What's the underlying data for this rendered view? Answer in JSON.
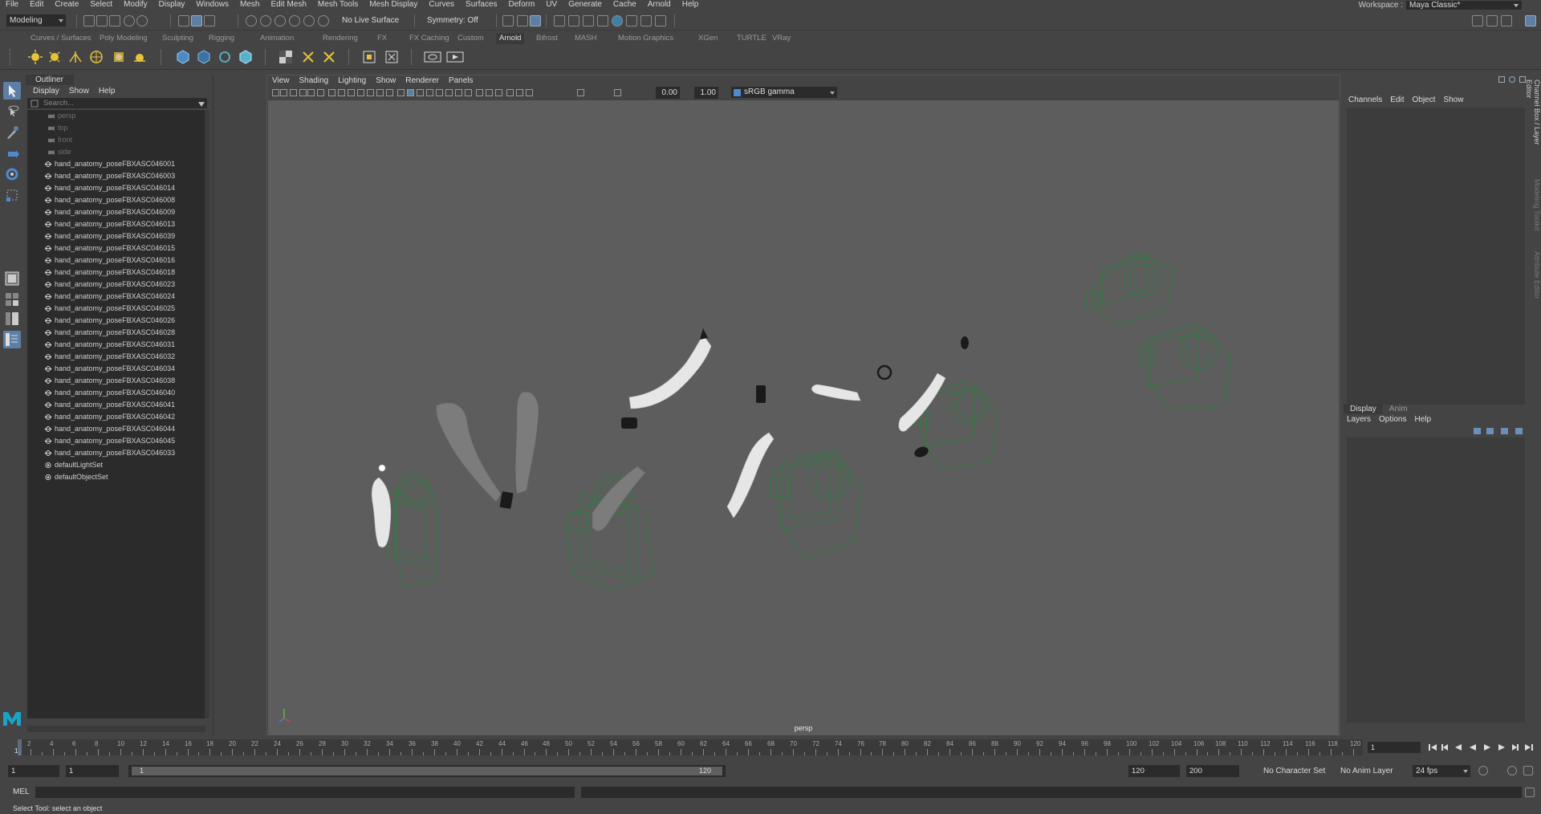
{
  "menubar": {
    "items": [
      "File",
      "Edit",
      "Create",
      "Select",
      "Modify",
      "Display",
      "Windows",
      "Mesh",
      "Edit Mesh",
      "Mesh Tools",
      "Mesh Display",
      "Curves",
      "Surfaces",
      "Deform",
      "UV",
      "Generate",
      "Cache",
      "Arnold",
      "Help"
    ],
    "workspace_label": "Workspace :",
    "workspace_value": "Maya Classic*"
  },
  "statusline": {
    "mode": "Modeling",
    "live_surface": "No Live Surface",
    "symmetry": "Symmetry: Off"
  },
  "shelf": {
    "tabs": [
      "Curves / Surfaces",
      "Poly Modeling",
      "Sculpting",
      "Rigging",
      "Animation",
      "Rendering",
      "FX",
      "FX Caching",
      "Custom",
      "Arnold",
      "Bifrost",
      "MASH",
      "Motion Graphics",
      "XGen",
      "TURTLE",
      "VRay"
    ],
    "active_tab": "Arnold"
  },
  "outliner": {
    "title": "Outliner",
    "menu": [
      "Display",
      "Show",
      "Help"
    ],
    "search_placeholder": "Search...",
    "cameras": [
      "persp",
      "top",
      "front",
      "side"
    ],
    "meshes": [
      "hand_anatomy_poseFBXASC046001",
      "hand_anatomy_poseFBXASC046003",
      "hand_anatomy_poseFBXASC046014",
      "hand_anatomy_poseFBXASC046008",
      "hand_anatomy_poseFBXASC046009",
      "hand_anatomy_poseFBXASC046013",
      "hand_anatomy_poseFBXASC046039",
      "hand_anatomy_poseFBXASC046015",
      "hand_anatomy_poseFBXASC046016",
      "hand_anatomy_poseFBXASC046018",
      "hand_anatomy_poseFBXASC046023",
      "hand_anatomy_poseFBXASC046024",
      "hand_anatomy_poseFBXASC046025",
      "hand_anatomy_poseFBXASC046026",
      "hand_anatomy_poseFBXASC046028",
      "hand_anatomy_poseFBXASC046031",
      "hand_anatomy_poseFBXASC046032",
      "hand_anatomy_poseFBXASC046034",
      "hand_anatomy_poseFBXASC046038",
      "hand_anatomy_poseFBXASC046040",
      "hand_anatomy_poseFBXASC046041",
      "hand_anatomy_poseFBXASC046042",
      "hand_anatomy_poseFBXASC046044",
      "hand_anatomy_poseFBXASC046045",
      "hand_anatomy_poseFBXASC046033"
    ],
    "sets": [
      "defaultLightSet",
      "defaultObjectSet"
    ]
  },
  "viewport": {
    "menu": [
      "View",
      "Shading",
      "Lighting",
      "Show",
      "Renderer",
      "Panels"
    ],
    "exposure": "0.00",
    "gamma": "1.00",
    "colorspace": "sRGB gamma",
    "camera_label": "persp"
  },
  "channelbox": {
    "menu": [
      "Channels",
      "Edit",
      "Object",
      "Show"
    ]
  },
  "layereditor": {
    "tabs": [
      "Display",
      "Anim"
    ],
    "menu": [
      "Layers",
      "Options",
      "Help"
    ]
  },
  "sidetabs": [
    "Channel Box / Layer Editor",
    "Modeling Toolkit",
    "Attribute Editor"
  ],
  "timeslider": {
    "ticks": [
      "2",
      "4",
      "6",
      "8",
      "10",
      "12",
      "14",
      "16",
      "18",
      "20",
      "22",
      "24",
      "26",
      "28",
      "30",
      "32",
      "34",
      "36",
      "38",
      "40",
      "42",
      "44",
      "46",
      "48",
      "50",
      "52",
      "54",
      "56",
      "58",
      "60",
      "62",
      "64",
      "66",
      "68",
      "70",
      "72",
      "74",
      "76",
      "78",
      "80",
      "82",
      "84",
      "86",
      "88",
      "90",
      "92",
      "94",
      "96",
      "98",
      "100",
      "102",
      "104",
      "106",
      "108",
      "110",
      "112",
      "114",
      "116",
      "118",
      "120"
    ],
    "current_frame_marker": "1",
    "current_frame": "1"
  },
  "rangeslider": {
    "start": "1",
    "playback_start": "1",
    "range_start": "1",
    "range_end": "120",
    "playback_end": "120",
    "end": "200",
    "character_set": "No Character Set",
    "anim_layer": "No Anim Layer",
    "fps": "24 fps"
  },
  "cmdline": {
    "label": "MEL"
  },
  "helpline": {
    "text": "Select Tool: select an object"
  },
  "colors": {
    "accent": "#5d7fa5",
    "wire": "#2e7d3e",
    "mesh": "#e6e6e6"
  }
}
